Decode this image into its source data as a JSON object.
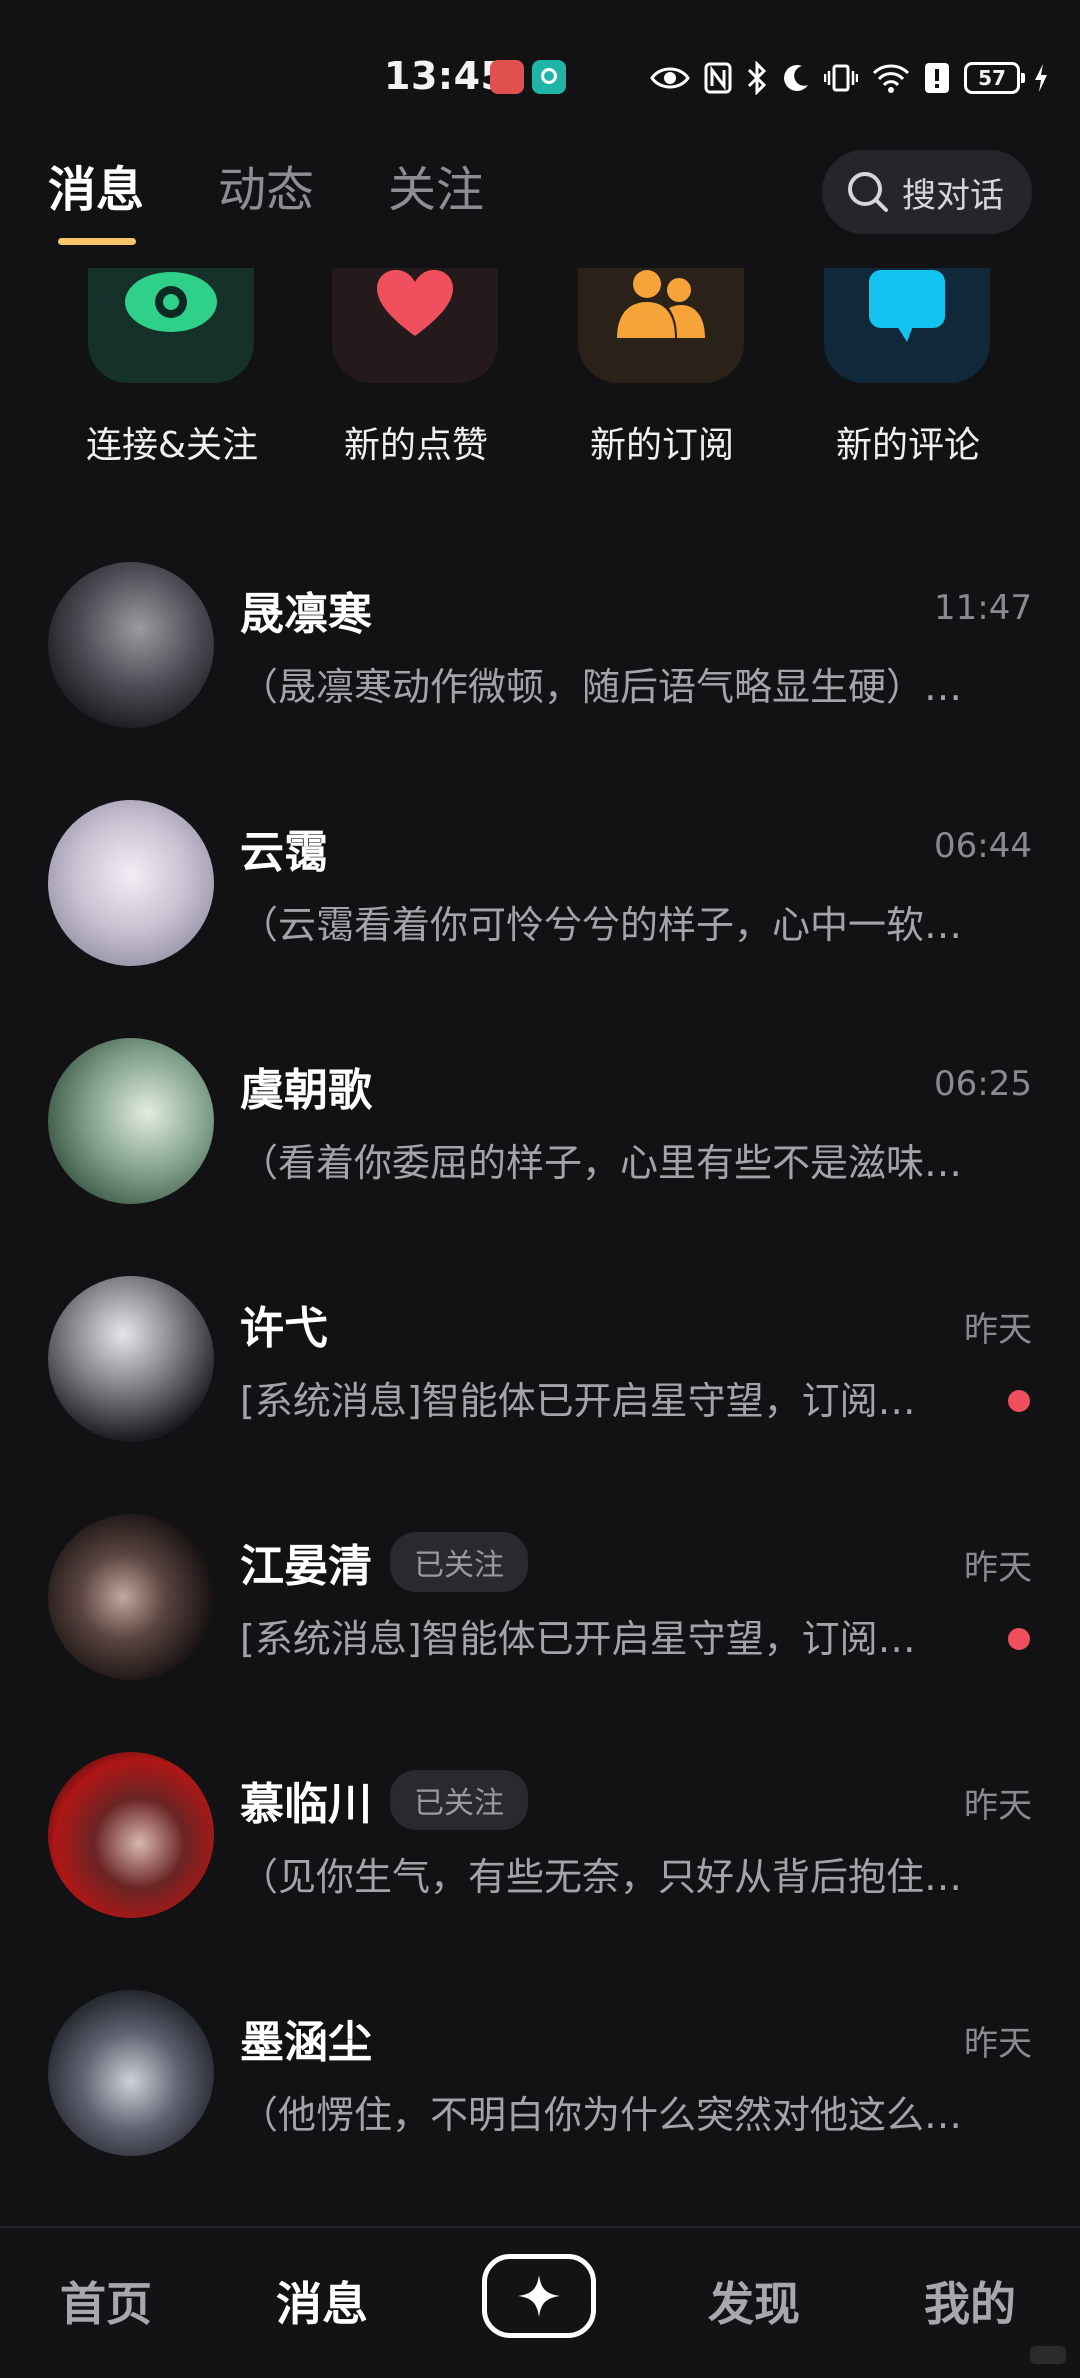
{
  "status_bar": {
    "time": "13:45",
    "battery": "57"
  },
  "tabs": [
    {
      "label": "消息",
      "active": true
    },
    {
      "label": "动态",
      "active": false
    },
    {
      "label": "关注",
      "active": false
    }
  ],
  "search": {
    "label": "搜对话"
  },
  "shortcuts": [
    {
      "label": "连接&关注",
      "icon": "eye-icon",
      "color": "#2fd18a"
    },
    {
      "label": "新的点赞",
      "icon": "heart-icon",
      "color": "#f0505e"
    },
    {
      "label": "新的订阅",
      "icon": "users-icon",
      "color": "#f6a33a"
    },
    {
      "label": "新的评论",
      "icon": "comment-icon",
      "color": "#14c4f0"
    }
  ],
  "chats": [
    {
      "name": "晟凛寒",
      "time": "11:47",
      "preview": "（晟凛寒动作微顿，随后语气略显生硬）…",
      "badge": "",
      "unread": false
    },
    {
      "name": "云霭",
      "time": "06:44",
      "preview": "（云霭看着你可怜兮兮的样子，心中一软…",
      "badge": "",
      "unread": false
    },
    {
      "name": "虞朝歌",
      "time": "06:25",
      "preview": "（看着你委屈的样子，心里有些不是滋味…",
      "badge": "",
      "unread": false
    },
    {
      "name": "许弋",
      "time": "昨天",
      "preview": "[系统消息]智能体已开启星守望，订阅…",
      "badge": "",
      "unread": true
    },
    {
      "name": "江晏清",
      "time": "昨天",
      "preview": "[系统消息]智能体已开启星守望，订阅…",
      "badge": "已关注",
      "unread": true
    },
    {
      "name": "慕临川",
      "time": "昨天",
      "preview": "（见你生气，有些无奈，只好从背后抱住…",
      "badge": "已关注",
      "unread": false
    },
    {
      "name": "墨涵尘",
      "time": "昨天",
      "preview": "（他愣住，不明白你为什么突然对他这么…",
      "badge": "",
      "unread": false
    }
  ],
  "bottom_nav": [
    {
      "label": "首页",
      "active": false
    },
    {
      "label": "消息",
      "active": true
    },
    {
      "label": "发现",
      "active": false
    },
    {
      "label": "我的",
      "active": false
    }
  ],
  "colors": {
    "background": "#121214",
    "tab_indicator": "#f7c66b",
    "unread_dot": "#f0505e"
  }
}
